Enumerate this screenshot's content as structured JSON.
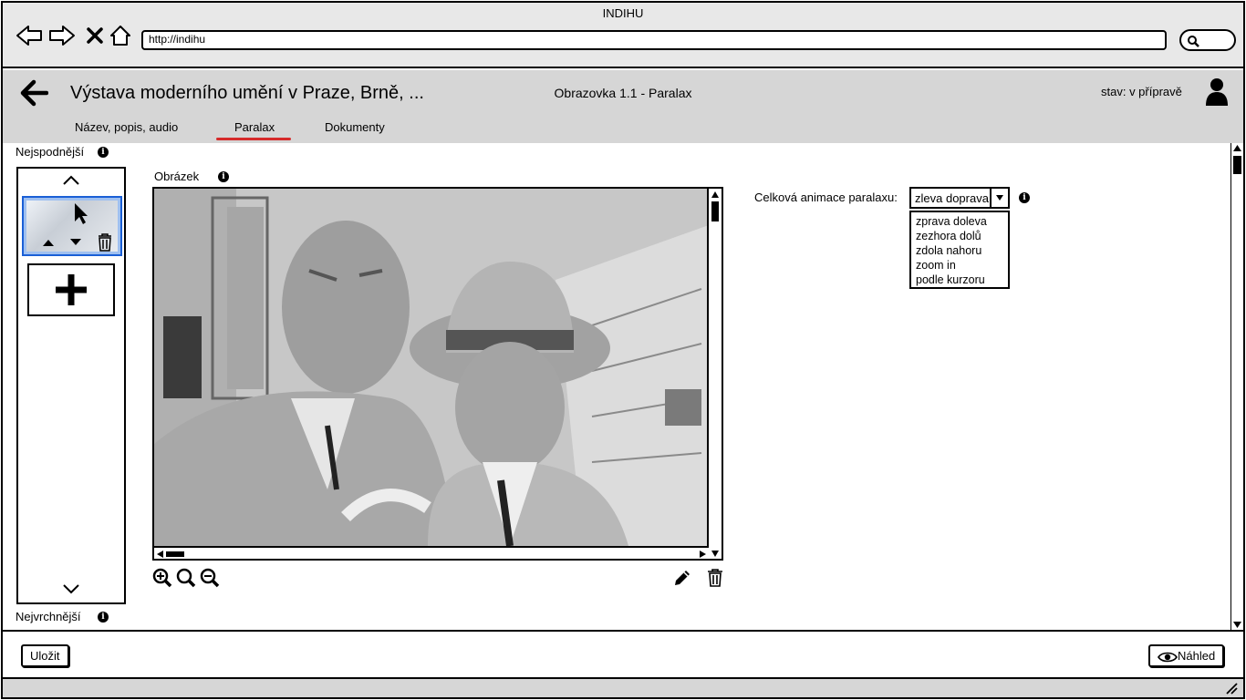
{
  "window": {
    "title": "INDIHU"
  },
  "browser": {
    "url": "http://indihu"
  },
  "header": {
    "title": "Výstava moderního umění v Praze, Brně, ...",
    "screen": "Obrazovka 1.1 - Paralax",
    "state": "stav: v přípravě"
  },
  "tabs": [
    {
      "label": "Název, popis, audio"
    },
    {
      "label": "Paralax",
      "active": true
    },
    {
      "label": "Dokumenty"
    }
  ],
  "layers": {
    "bottom_label": "Nejspodnější",
    "top_label": "Nejvrchnější"
  },
  "image_panel": {
    "label": "Obrázek"
  },
  "animation": {
    "label": "Celková animace paralaxu:",
    "selected": "zleva doprava",
    "options": [
      "zprava doleva",
      "zezhora dolů",
      "zdola nahoru",
      "zoom in",
      "podle kurzoru"
    ]
  },
  "footer": {
    "save": "Uložit",
    "preview": "Náhled"
  },
  "colors": {
    "accent": "#d62b2b",
    "selection": "#1a5fd6",
    "chrome": "#d6d6d6"
  }
}
